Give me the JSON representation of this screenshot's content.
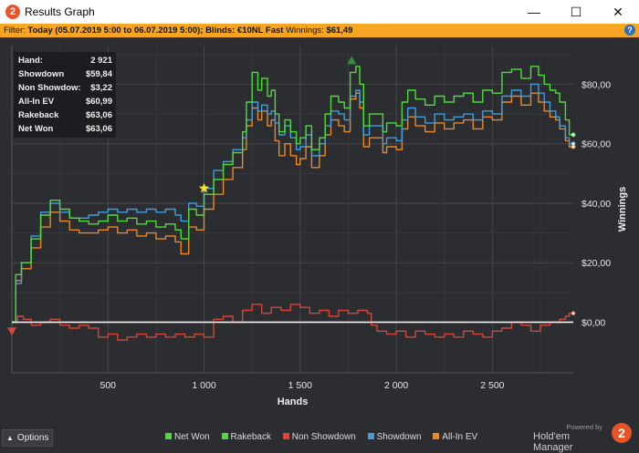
{
  "window": {
    "title": "Results Graph",
    "app_icon_label": "2",
    "minimize": "—",
    "maximize": "☐",
    "close": "✕"
  },
  "filter": {
    "prefix": "Filter:",
    "text": "Today (05.07.2019 5:00 to 06.07.2019 5:00); Blinds: €10NL Fast",
    "winnings_label": "Winnings:",
    "winnings_value": "$61,49",
    "help": "?"
  },
  "stats": [
    {
      "label": "Hand:",
      "value": "2 921"
    },
    {
      "label": "Showdown",
      "value": "$59,84"
    },
    {
      "label": "Non Showdow:",
      "value": "$3,22"
    },
    {
      "label": "All-In EV",
      "value": "$60,99"
    },
    {
      "label": "Rakeback",
      "value": "$63,06"
    },
    {
      "label": "Net Won",
      "value": "$63,06"
    }
  ],
  "bottom": {
    "options_label": "Options",
    "powered_by": "Powered by",
    "brand": "Hold'em Manager",
    "brand_logo": "2"
  },
  "colors": {
    "net_won": "#4fdc3a",
    "rakeback": "#4fdc3a",
    "non_showdown": "#d8453a",
    "showdown": "#3f9ee0",
    "allin_ev": "#e9882a",
    "zero_line": "#ffffff",
    "background": "#2b2d31"
  },
  "chart_data": {
    "type": "line",
    "xlabel": "Hands",
    "ylabel": "Winnings",
    "xlim": [
      0,
      2921
    ],
    "ylim": [
      -17,
      93
    ],
    "x_ticks": [
      500,
      1000,
      1500,
      2000,
      2500
    ],
    "x_tick_labels": [
      "500",
      "1 000",
      "1 500",
      "2 000",
      "2 500"
    ],
    "y_ticks": [
      0,
      20,
      40,
      60,
      80
    ],
    "y_tick_labels": [
      "$0,00",
      "$20,00",
      "$40,00",
      "$60,00",
      "$80,00"
    ],
    "legend": [
      {
        "name": "Net Won",
        "color": "#4fdc3a"
      },
      {
        "name": "Rakeback",
        "color": "#4fdc3a"
      },
      {
        "name": "Non Showdown",
        "color": "#d8453a"
      },
      {
        "name": "Showdown",
        "color": "#3f9ee0"
      },
      {
        "name": "All-In EV",
        "color": "#e9882a"
      }
    ],
    "series": [
      {
        "name": "Net Won",
        "color": "#4fdc3a",
        "points": [
          [
            0,
            0
          ],
          [
            20,
            16
          ],
          [
            50,
            20
          ],
          [
            100,
            28
          ],
          [
            150,
            36
          ],
          [
            200,
            41
          ],
          [
            250,
            38
          ],
          [
            300,
            35
          ],
          [
            350,
            34
          ],
          [
            400,
            33
          ],
          [
            450,
            34
          ],
          [
            500,
            36
          ],
          [
            550,
            34
          ],
          [
            600,
            35
          ],
          [
            650,
            33
          ],
          [
            700,
            34
          ],
          [
            750,
            32
          ],
          [
            800,
            33
          ],
          [
            850,
            31
          ],
          [
            880,
            28
          ],
          [
            920,
            38
          ],
          [
            960,
            36
          ],
          [
            1000,
            43
          ],
          [
            1050,
            48
          ],
          [
            1100,
            53
          ],
          [
            1150,
            57
          ],
          [
            1200,
            64
          ],
          [
            1220,
            74
          ],
          [
            1250,
            84
          ],
          [
            1280,
            78
          ],
          [
            1300,
            82
          ],
          [
            1330,
            76
          ],
          [
            1350,
            78
          ],
          [
            1370,
            70
          ],
          [
            1390,
            64
          ],
          [
            1420,
            68
          ],
          [
            1450,
            64
          ],
          [
            1480,
            60
          ],
          [
            1500,
            62
          ],
          [
            1530,
            66
          ],
          [
            1560,
            58
          ],
          [
            1600,
            62
          ],
          [
            1630,
            70
          ],
          [
            1660,
            76
          ],
          [
            1700,
            74
          ],
          [
            1730,
            72
          ],
          [
            1760,
            84
          ],
          [
            1790,
            86
          ],
          [
            1810,
            80
          ],
          [
            1830,
            66
          ],
          [
            1860,
            70
          ],
          [
            1900,
            70
          ],
          [
            1930,
            64
          ],
          [
            1950,
            67
          ],
          [
            2000,
            66
          ],
          [
            2030,
            74
          ],
          [
            2060,
            78
          ],
          [
            2100,
            75
          ],
          [
            2150,
            73
          ],
          [
            2200,
            76
          ],
          [
            2250,
            74
          ],
          [
            2300,
            76
          ],
          [
            2350,
            77
          ],
          [
            2400,
            74
          ],
          [
            2450,
            78
          ],
          [
            2500,
            77
          ],
          [
            2550,
            84
          ],
          [
            2600,
            85
          ],
          [
            2650,
            82
          ],
          [
            2700,
            86
          ],
          [
            2740,
            83
          ],
          [
            2770,
            80
          ],
          [
            2800,
            78
          ],
          [
            2830,
            77
          ],
          [
            2850,
            74
          ],
          [
            2880,
            68
          ],
          [
            2900,
            63
          ],
          [
            2921,
            63
          ]
        ]
      },
      {
        "name": "Showdown",
        "color": "#3f9ee0",
        "points": [
          [
            0,
            0
          ],
          [
            20,
            13
          ],
          [
            50,
            20
          ],
          [
            100,
            29
          ],
          [
            150,
            37
          ],
          [
            200,
            40
          ],
          [
            250,
            37
          ],
          [
            300,
            35
          ],
          [
            350,
            35
          ],
          [
            400,
            36
          ],
          [
            450,
            37
          ],
          [
            500,
            38
          ],
          [
            550,
            37
          ],
          [
            600,
            38
          ],
          [
            650,
            37
          ],
          [
            700,
            38
          ],
          [
            750,
            37
          ],
          [
            800,
            38
          ],
          [
            850,
            36
          ],
          [
            880,
            34
          ],
          [
            920,
            40
          ],
          [
            960,
            39
          ],
          [
            1000,
            45
          ],
          [
            1050,
            51
          ],
          [
            1100,
            54
          ],
          [
            1150,
            58
          ],
          [
            1200,
            62
          ],
          [
            1220,
            68
          ],
          [
            1250,
            74
          ],
          [
            1280,
            71
          ],
          [
            1300,
            73
          ],
          [
            1330,
            70
          ],
          [
            1350,
            71
          ],
          [
            1370,
            67
          ],
          [
            1390,
            63
          ],
          [
            1420,
            66
          ],
          [
            1450,
            62
          ],
          [
            1480,
            58
          ],
          [
            1500,
            59
          ],
          [
            1530,
            63
          ],
          [
            1560,
            56
          ],
          [
            1600,
            60
          ],
          [
            1630,
            66
          ],
          [
            1660,
            71
          ],
          [
            1700,
            70
          ],
          [
            1730,
            68
          ],
          [
            1760,
            76
          ],
          [
            1790,
            78
          ],
          [
            1810,
            74
          ],
          [
            1830,
            63
          ],
          [
            1860,
            66
          ],
          [
            1900,
            66
          ],
          [
            1930,
            60
          ],
          [
            1950,
            62
          ],
          [
            2000,
            61
          ],
          [
            2030,
            68
          ],
          [
            2060,
            72
          ],
          [
            2100,
            69
          ],
          [
            2150,
            67
          ],
          [
            2200,
            70
          ],
          [
            2250,
            68
          ],
          [
            2300,
            69
          ],
          [
            2350,
            70
          ],
          [
            2400,
            68
          ],
          [
            2450,
            71
          ],
          [
            2500,
            70
          ],
          [
            2550,
            76
          ],
          [
            2600,
            78
          ],
          [
            2650,
            76
          ],
          [
            2700,
            80
          ],
          [
            2740,
            77
          ],
          [
            2770,
            74
          ],
          [
            2800,
            71
          ],
          [
            2830,
            69
          ],
          [
            2850,
            66
          ],
          [
            2880,
            62
          ],
          [
            2900,
            60
          ],
          [
            2921,
            60
          ]
        ]
      },
      {
        "name": "All-In EV",
        "color": "#e9882a",
        "points": [
          [
            0,
            0
          ],
          [
            20,
            14
          ],
          [
            50,
            18
          ],
          [
            100,
            25
          ],
          [
            150,
            32
          ],
          [
            200,
            37
          ],
          [
            250,
            34
          ],
          [
            300,
            31
          ],
          [
            350,
            30
          ],
          [
            400,
            30
          ],
          [
            450,
            31
          ],
          [
            500,
            32
          ],
          [
            550,
            30
          ],
          [
            600,
            31
          ],
          [
            650,
            29
          ],
          [
            700,
            30
          ],
          [
            750,
            28
          ],
          [
            800,
            29
          ],
          [
            850,
            27
          ],
          [
            880,
            23
          ],
          [
            920,
            32
          ],
          [
            960,
            31
          ],
          [
            1000,
            38
          ],
          [
            1050,
            43
          ],
          [
            1100,
            48
          ],
          [
            1150,
            52
          ],
          [
            1200,
            58
          ],
          [
            1220,
            66
          ],
          [
            1250,
            72
          ],
          [
            1280,
            68
          ],
          [
            1300,
            71
          ],
          [
            1330,
            66
          ],
          [
            1350,
            68
          ],
          [
            1370,
            61
          ],
          [
            1390,
            56
          ],
          [
            1420,
            60
          ],
          [
            1450,
            56
          ],
          [
            1480,
            53
          ],
          [
            1500,
            55
          ],
          [
            1530,
            59
          ],
          [
            1560,
            52
          ],
          [
            1600,
            56
          ],
          [
            1630,
            63
          ],
          [
            1660,
            68
          ],
          [
            1700,
            66
          ],
          [
            1730,
            64
          ],
          [
            1760,
            75
          ],
          [
            1790,
            77
          ],
          [
            1810,
            72
          ],
          [
            1830,
            59
          ],
          [
            1860,
            62
          ],
          [
            1900,
            62
          ],
          [
            1930,
            57
          ],
          [
            1950,
            59
          ],
          [
            2000,
            58
          ],
          [
            2030,
            65
          ],
          [
            2060,
            69
          ],
          [
            2100,
            66
          ],
          [
            2150,
            64
          ],
          [
            2200,
            67
          ],
          [
            2250,
            65
          ],
          [
            2300,
            67
          ],
          [
            2350,
            68
          ],
          [
            2400,
            65
          ],
          [
            2450,
            69
          ],
          [
            2500,
            68
          ],
          [
            2550,
            74
          ],
          [
            2600,
            76
          ],
          [
            2650,
            73
          ],
          [
            2700,
            77
          ],
          [
            2740,
            74
          ],
          [
            2770,
            71
          ],
          [
            2800,
            69
          ],
          [
            2830,
            68
          ],
          [
            2850,
            65
          ],
          [
            2880,
            61
          ],
          [
            2900,
            59
          ],
          [
            2921,
            59
          ]
        ]
      },
      {
        "name": "Non Showdown",
        "color": "#d8453a",
        "points": [
          [
            0,
            0
          ],
          [
            30,
            2
          ],
          [
            60,
            1
          ],
          [
            100,
            -1
          ],
          [
            150,
            0
          ],
          [
            200,
            1
          ],
          [
            250,
            -1
          ],
          [
            300,
            -2
          ],
          [
            350,
            -1
          ],
          [
            400,
            -2
          ],
          [
            450,
            -5
          ],
          [
            500,
            -4
          ],
          [
            550,
            -6
          ],
          [
            600,
            -5
          ],
          [
            650,
            -4
          ],
          [
            700,
            -5
          ],
          [
            750,
            -4
          ],
          [
            800,
            -5
          ],
          [
            850,
            -4
          ],
          [
            900,
            -5
          ],
          [
            950,
            -4
          ],
          [
            1000,
            -5
          ],
          [
            1050,
            1
          ],
          [
            1100,
            2
          ],
          [
            1150,
            0
          ],
          [
            1200,
            4
          ],
          [
            1250,
            6
          ],
          [
            1300,
            3
          ],
          [
            1350,
            5
          ],
          [
            1400,
            4
          ],
          [
            1450,
            6
          ],
          [
            1500,
            5
          ],
          [
            1550,
            3
          ],
          [
            1600,
            4
          ],
          [
            1650,
            2
          ],
          [
            1700,
            4
          ],
          [
            1750,
            3
          ],
          [
            1800,
            4
          ],
          [
            1850,
            3
          ],
          [
            1870,
            -1
          ],
          [
            1900,
            -3
          ],
          [
            1950,
            -4
          ],
          [
            2000,
            -3
          ],
          [
            2050,
            -5
          ],
          [
            2100,
            -3
          ],
          [
            2150,
            -4
          ],
          [
            2200,
            -5
          ],
          [
            2250,
            -4
          ],
          [
            2300,
            -5
          ],
          [
            2350,
            -3
          ],
          [
            2400,
            -4
          ],
          [
            2450,
            -5
          ],
          [
            2500,
            -3
          ],
          [
            2550,
            -2
          ],
          [
            2600,
            0
          ],
          [
            2650,
            -1
          ],
          [
            2700,
            -3
          ],
          [
            2750,
            -1
          ],
          [
            2800,
            0
          ],
          [
            2850,
            1
          ],
          [
            2880,
            2
          ],
          [
            2900,
            3
          ],
          [
            2921,
            3
          ]
        ]
      }
    ],
    "markers": [
      {
        "type": "max",
        "color": "#2f8f3a",
        "x": 1768,
        "y": 88
      },
      {
        "type": "min",
        "color": "#d8453a",
        "x": 0,
        "y": -3
      },
      {
        "type": "star",
        "color": "#f5e12a",
        "x": 1000,
        "y": 45
      }
    ],
    "grid": true,
    "legend_position": "bottom"
  }
}
